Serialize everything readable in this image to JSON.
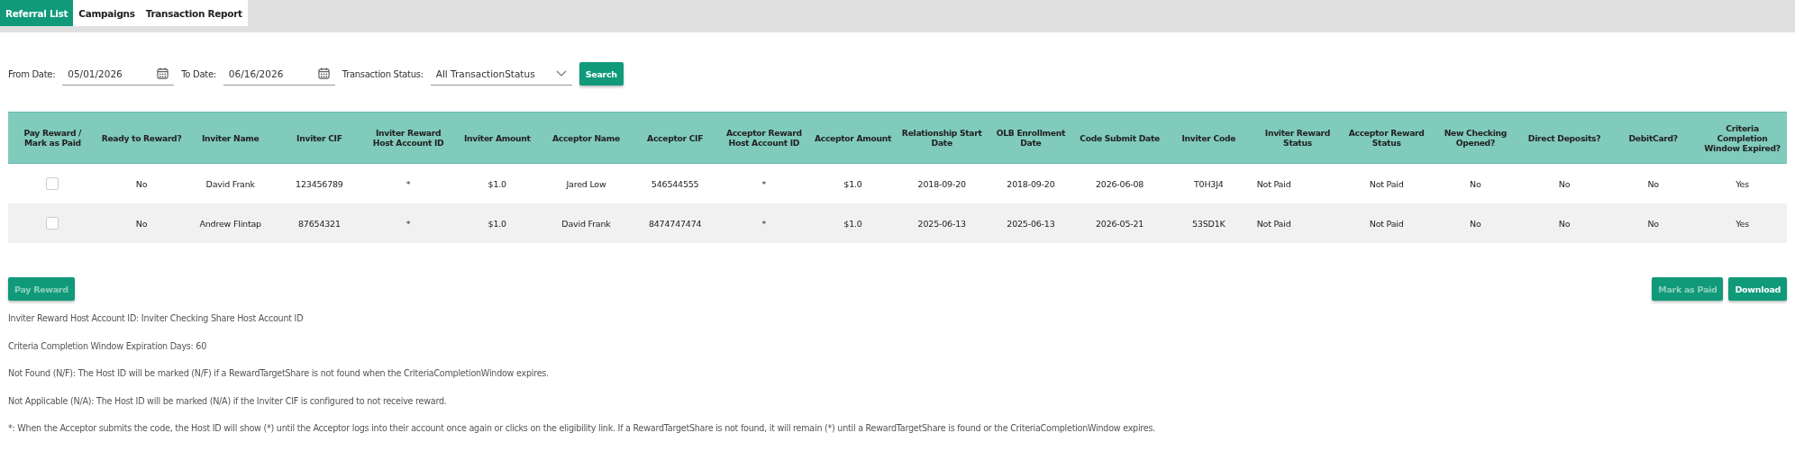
{
  "tabs": [
    {
      "label": "Referral List",
      "selected": true
    },
    {
      "label": "Campaigns",
      "selected": false
    },
    {
      "label": "Transaction Report",
      "selected": false
    }
  ],
  "filters": {
    "from_date": {
      "label": "From Date:",
      "value": "05/01/2026"
    },
    "to_date": {
      "label": "To Date:",
      "value": "06/16/2026"
    },
    "transaction_status": {
      "label": "Transaction Status:",
      "value": "All TransactionStatus"
    },
    "search_button": "Search"
  },
  "table": {
    "columns": [
      "Pay Reward / Mark as Paid",
      "Ready to Reward?",
      "Inviter Name",
      "Inviter CIF",
      "Inviter Reward Host Account ID",
      "Inviter Amount",
      "Acceptor Name",
      "Acceptor CIF",
      "Acceptor Reward Host Account ID",
      "Acceptor Amount",
      "Relationship Start Date",
      "OLB Enrollment Date",
      "Code Submit Date",
      "Inviter Code",
      "Inviter Reward Status",
      "Acceptor Reward Status",
      "New Checking Opened?",
      "Direct Deposits?",
      "DebitCard?",
      "Criteria Completion Window Expired?"
    ],
    "rows": [
      {
        "cells": [
          {
            "kind": "checkbox",
            "checked": false
          },
          "No",
          "David Frank",
          "123456789",
          "*",
          "$1.0",
          "Jared Low",
          "546544555",
          "*",
          "$1.0",
          "2018-09-20",
          "2018-09-20",
          "2026-06-08",
          "T0H3J4",
          "Not Paid",
          "Not Paid",
          "No",
          "No",
          "No",
          "Yes"
        ]
      },
      {
        "cells": [
          {
            "kind": "checkbox",
            "checked": false
          },
          "No",
          "Andrew Flintap",
          "87654321",
          "*",
          "$1.0",
          "David Frank",
          "8474747474",
          "*",
          "$1.0",
          "2025-06-13",
          "2025-06-13",
          "2026-05-21",
          "53SD1K",
          "Not Paid",
          "Not Paid",
          "No",
          "No",
          "No",
          "Yes"
        ]
      }
    ]
  },
  "actions": {
    "left": [
      {
        "label": "Pay Reward",
        "disabled": true
      }
    ],
    "right": [
      {
        "label": "Mark as Paid",
        "disabled": true
      },
      {
        "label": "Download",
        "disabled": false
      }
    ]
  },
  "notes": [
    "Inviter Reward Host Account ID: Inviter Checking Share Host Account ID",
    "Criteria Completion Window Expiration Days: 60",
    "Not Found (N/F): The Host ID will be marked (N/F) if a RewardTargetShare is not found when the CriteriaCompletionWindow expires.",
    "Not Applicable (N/A): The Host ID will be marked (N/A) if the Inviter CIF is configured to not receive reward.",
    "*: When the Acceptor submits the code, the Host ID will show (*) until the Acceptor logs into their account once again or clicks on the eligibility link. If a RewardTargetShare is not found, it will remain (*) until a RewardTargetShare is found or the CriteriaCompletionWindow expires."
  ]
}
